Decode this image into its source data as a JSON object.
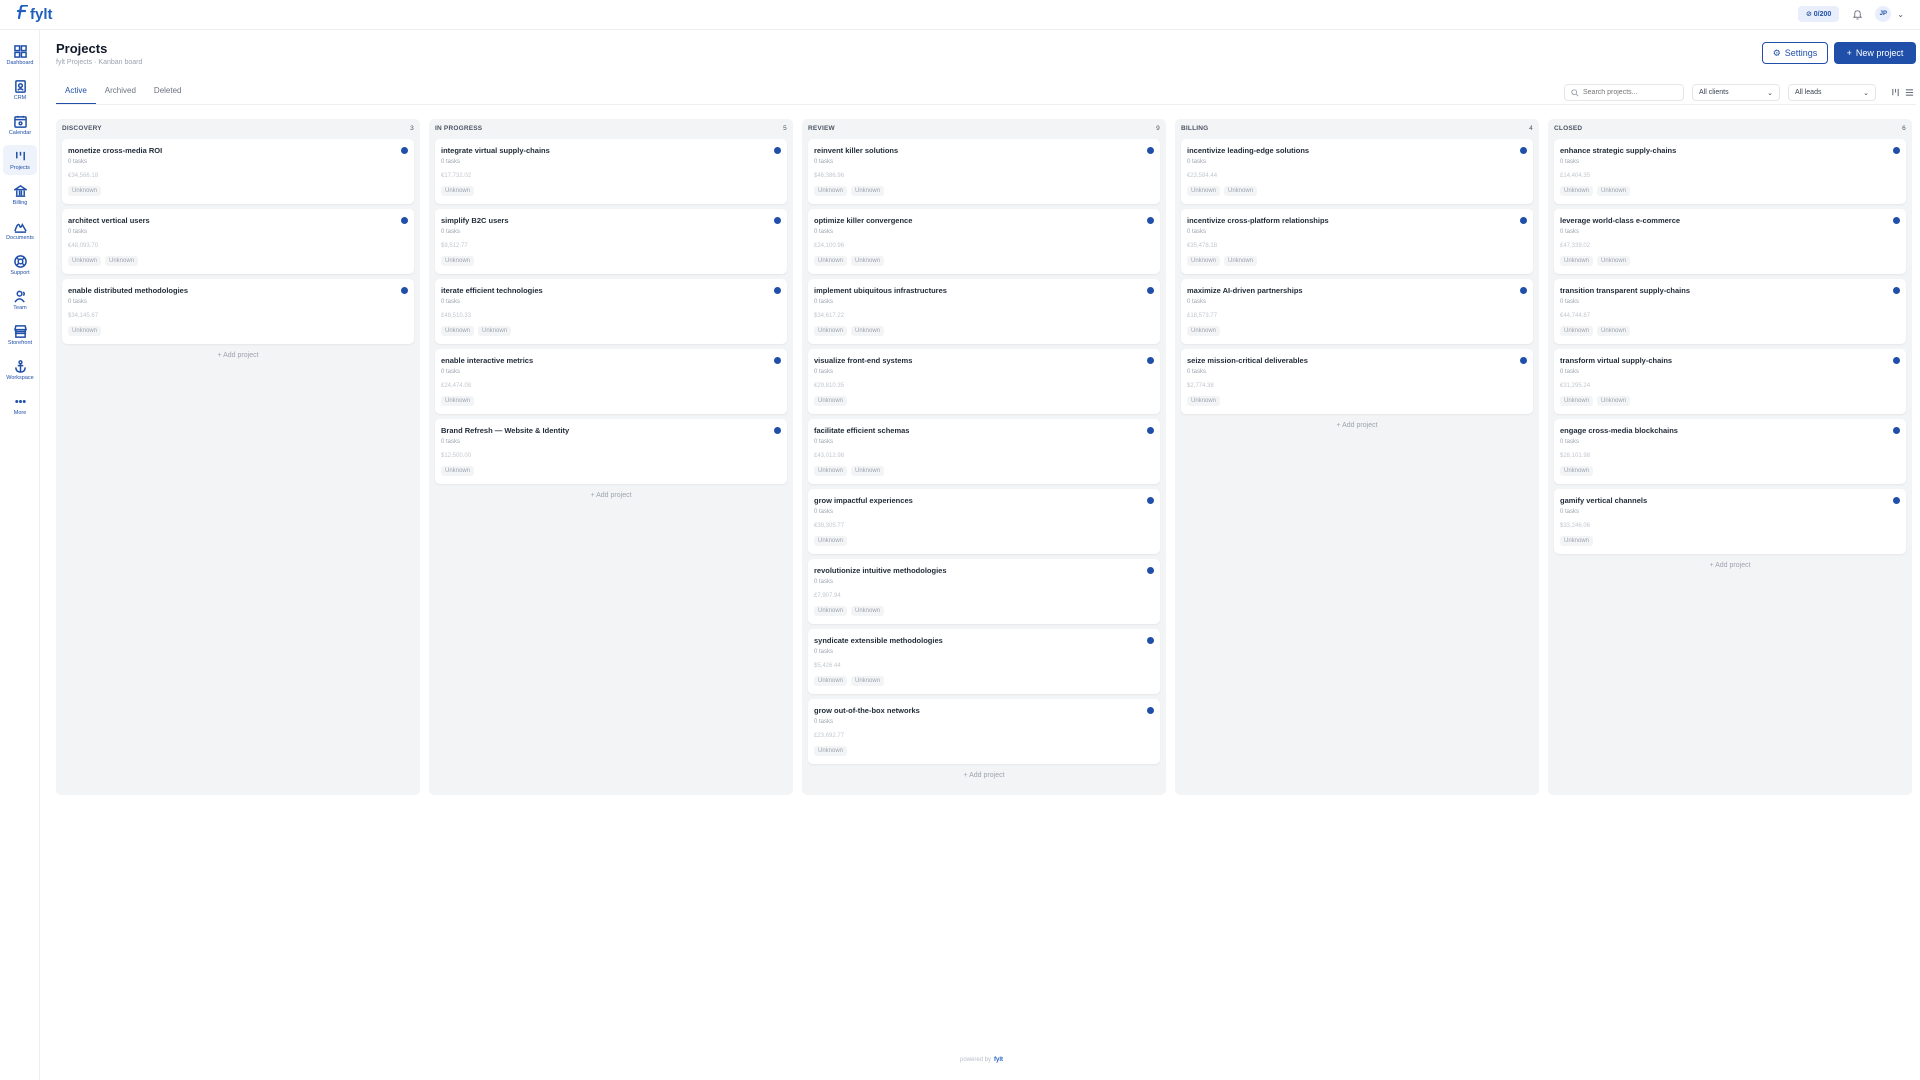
{
  "app": {
    "logo_text": "fylt",
    "credits": "0/200",
    "avatar_initials": "JP"
  },
  "sidebar": {
    "items": [
      {
        "label": "Dashboard",
        "icon": "grid-icon"
      },
      {
        "label": "CRM",
        "icon": "contact-card-icon"
      },
      {
        "label": "Calendar",
        "icon": "calendar-icon"
      },
      {
        "label": "Projects",
        "icon": "kanban-icon",
        "active": true
      },
      {
        "label": "Billing",
        "icon": "bank-icon"
      },
      {
        "label": "Documents",
        "icon": "signature-icon"
      },
      {
        "label": "Support",
        "icon": "lifebuoy-icon"
      },
      {
        "label": "Team",
        "icon": "users-icon"
      },
      {
        "label": "Storefront",
        "icon": "store-icon"
      },
      {
        "label": "Workspace",
        "icon": "anchor-icon"
      },
      {
        "label": "More",
        "icon": "more-icon"
      }
    ]
  },
  "header": {
    "title": "Projects",
    "subtitle": "fylt Projects · Kanban board",
    "settings_label": "Settings",
    "new_project_label": "New project"
  },
  "tabs": [
    {
      "label": "Active",
      "active": true
    },
    {
      "label": "Archived"
    },
    {
      "label": "Deleted"
    }
  ],
  "filters": {
    "search_placeholder": "Search projects...",
    "clients_value": "All clients",
    "leads_value": "All leads"
  },
  "add_project_label": "+ Add project",
  "columns": [
    {
      "name": "DISCOVERY",
      "count": "3",
      "cards": [
        {
          "title": "monetize cross-media ROI",
          "tasks": "0 tasks",
          "amount": "€34,566.18",
          "tags": [
            "Unknown"
          ]
        },
        {
          "title": "architect vertical users",
          "tasks": "0 tasks",
          "amount": "€48,093.70",
          "tags": [
            "Unknown",
            "Unknown"
          ]
        },
        {
          "title": "enable distributed methodologies",
          "tasks": "0 tasks",
          "amount": "$34,145.67",
          "tags": [
            "Unknown"
          ]
        }
      ]
    },
    {
      "name": "IN PROGRESS",
      "count": "5",
      "cards": [
        {
          "title": "integrate virtual supply-chains",
          "tasks": "0 tasks",
          "amount": "€17,732.02",
          "tags": [
            "Unknown"
          ]
        },
        {
          "title": "simplify B2C users",
          "tasks": "0 tasks",
          "amount": "$9,512.77",
          "tags": [
            "Unknown"
          ]
        },
        {
          "title": "iterate efficient technologies",
          "tasks": "0 tasks",
          "amount": "£48,510.33",
          "tags": [
            "Unknown",
            "Unknown"
          ]
        },
        {
          "title": "enable interactive metrics",
          "tasks": "0 tasks",
          "amount": "£24,474.08",
          "tags": [
            "Unknown"
          ]
        },
        {
          "title": "Brand Refresh — Website & Identity",
          "tasks": "0 tasks",
          "amount": "$12,500.00",
          "tags": [
            "Unknown"
          ]
        }
      ]
    },
    {
      "name": "REVIEW",
      "count": "9",
      "cards": [
        {
          "title": "reinvent killer solutions",
          "tasks": "0 tasks",
          "amount": "$46,386.96",
          "tags": [
            "Unknown",
            "Unknown"
          ]
        },
        {
          "title": "optimize killer convergence",
          "tasks": "0 tasks",
          "amount": "£24,100.96",
          "tags": [
            "Unknown",
            "Unknown"
          ]
        },
        {
          "title": "implement ubiquitous infrastructures",
          "tasks": "0 tasks",
          "amount": "$34,617.22",
          "tags": [
            "Unknown",
            "Unknown"
          ]
        },
        {
          "title": "visualize front-end systems",
          "tasks": "0 tasks",
          "amount": "€29,810.35",
          "tags": [
            "Unknown"
          ]
        },
        {
          "title": "facilitate efficient schemas",
          "tasks": "0 tasks",
          "amount": "£43,012.98",
          "tags": [
            "Unknown",
            "Unknown"
          ]
        },
        {
          "title": "grow impactful experiences",
          "tasks": "0 tasks",
          "amount": "€39,305.77",
          "tags": [
            "Unknown"
          ]
        },
        {
          "title": "revolutionize intuitive methodologies",
          "tasks": "0 tasks",
          "amount": "£7,907.94",
          "tags": [
            "Unknown",
            "Unknown"
          ]
        },
        {
          "title": "syndicate extensible methodologies",
          "tasks": "0 tasks",
          "amount": "$5,426.44",
          "tags": [
            "Unknown",
            "Unknown"
          ]
        },
        {
          "title": "grow out-of-the-box networks",
          "tasks": "0 tasks",
          "amount": "£23,692.77",
          "tags": [
            "Unknown"
          ]
        }
      ]
    },
    {
      "name": "BILLING",
      "count": "4",
      "cards": [
        {
          "title": "incentivize leading-edge solutions",
          "tasks": "0 tasks",
          "amount": "€23,584.44",
          "tags": [
            "Unknown",
            "Unknown"
          ]
        },
        {
          "title": "incentivize cross-platform relationships",
          "tasks": "0 tasks",
          "amount": "€35,478.18",
          "tags": [
            "Unknown",
            "Unknown"
          ]
        },
        {
          "title": "maximize AI-driven partnerships",
          "tasks": "0 tasks",
          "amount": "£18,573.77",
          "tags": [
            "Unknown"
          ]
        },
        {
          "title": "seize mission-critical deliverables",
          "tasks": "0 tasks",
          "amount": "$2,774.38",
          "tags": [
            "Unknown"
          ]
        }
      ]
    },
    {
      "name": "CLOSED",
      "count": "6",
      "cards": [
        {
          "title": "enhance strategic supply-chains",
          "tasks": "0 tasks",
          "amount": "£14,404.35",
          "tags": [
            "Unknown",
            "Unknown"
          ]
        },
        {
          "title": "leverage world-class e-commerce",
          "tasks": "0 tasks",
          "amount": "£47,339.02",
          "tags": [
            "Unknown",
            "Unknown"
          ]
        },
        {
          "title": "transition transparent supply-chains",
          "tasks": "0 tasks",
          "amount": "€44,744.87",
          "tags": [
            "Unknown",
            "Unknown"
          ]
        },
        {
          "title": "transform virtual supply-chains",
          "tasks": "0 tasks",
          "amount": "€31,295.24",
          "tags": [
            "Unknown",
            "Unknown"
          ]
        },
        {
          "title": "engage cross-media blockchains",
          "tasks": "0 tasks",
          "amount": "$28,101.98",
          "tags": [
            "Unknown"
          ]
        },
        {
          "title": "gamify vertical channels",
          "tasks": "0 tasks",
          "amount": "$33,246.06",
          "tags": [
            "Unknown"
          ]
        }
      ]
    }
  ],
  "footer": {
    "powered_by": "powered by",
    "brand": "fylt"
  },
  "colors": {
    "accent": "#1f4fa8",
    "column_bg": "#f3f4f6",
    "status_dot": "#1f4fa8"
  }
}
